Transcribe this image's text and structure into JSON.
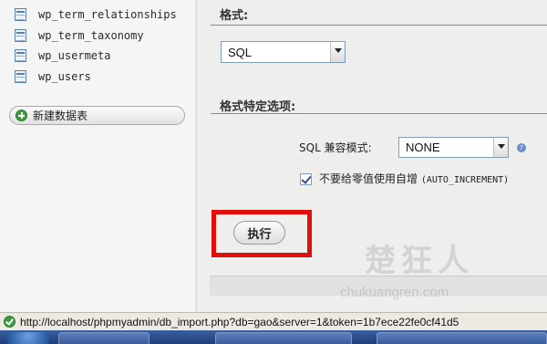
{
  "nav": {
    "tables": [
      {
        "name": "wp_term_relationships"
      },
      {
        "name": "wp_term_taxonomy"
      },
      {
        "name": "wp_usermeta"
      },
      {
        "name": "wp_users"
      }
    ],
    "new_table_label": "新建数据表"
  },
  "main": {
    "format_title": "格式:",
    "format_select": {
      "value": "SQL"
    },
    "options_title": "格式特定选项:",
    "compat_label": "SQL 兼容模式:",
    "compat_select": {
      "value": "NONE"
    },
    "help_icon": "?",
    "ai_checkbox": {
      "checked": true,
      "label_cn": "不要给零值使用自增",
      "label_code": "(AUTO_INCREMENT)"
    },
    "execute_label": "执行"
  },
  "watermark": {
    "cn": "楚狂人",
    "en": "chukuangren.com"
  },
  "status_bar": {
    "url": "http://localhost/phpmyadmin/db_import.php?db=gao&server=1&token=1b7ece22fe0cf41d5"
  },
  "colors": {
    "highlight": "#e10e0e",
    "nav_bg": "#f5f5f5",
    "main_bg": "#eeeeec",
    "taskbar": "#2a4c8a"
  }
}
